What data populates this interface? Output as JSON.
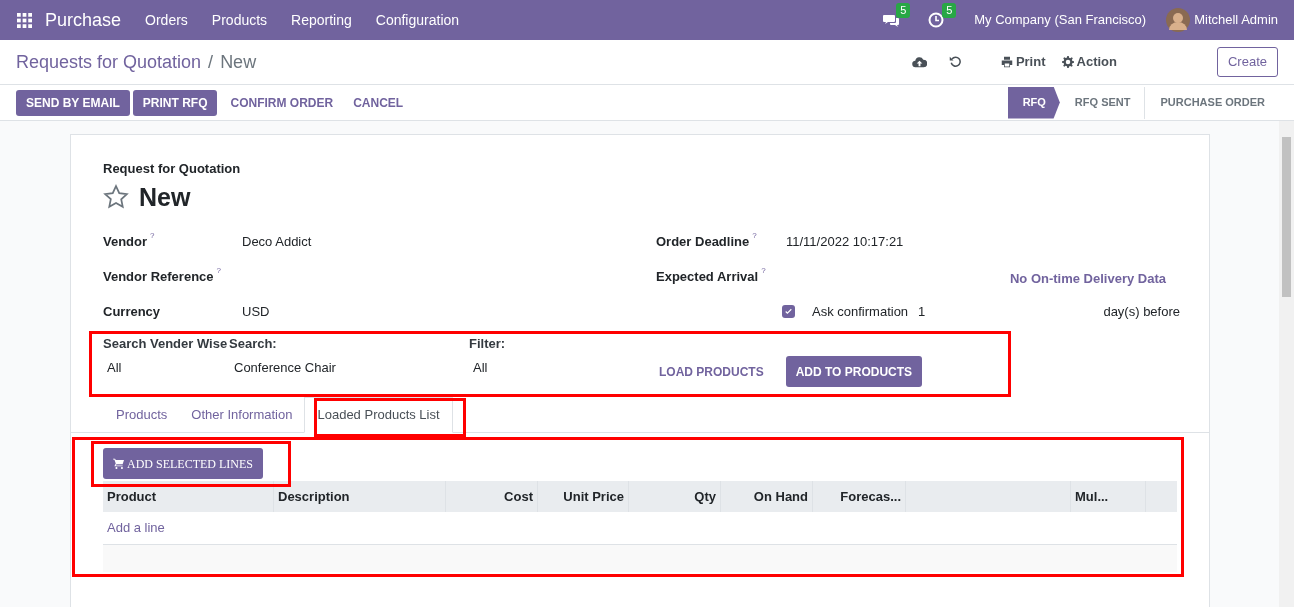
{
  "topbar": {
    "app_name": "Purchase",
    "menu": [
      "Orders",
      "Products",
      "Reporting",
      "Configuration"
    ],
    "messages_count": "5",
    "activities_count": "5",
    "company": "My Company (San Francisco)",
    "user": "Mitchell Admin"
  },
  "breadcrumb": {
    "parent": "Requests for Quotation",
    "separator": "/",
    "current": "New"
  },
  "control_panel": {
    "actions": [
      {
        "kind": "print",
        "label": "Print"
      },
      {
        "kind": "gear",
        "label": "Action"
      }
    ],
    "create": "Create"
  },
  "action_buttons": [
    {
      "label": "SEND BY EMAIL",
      "kind": "primary"
    },
    {
      "label": "PRINT RFQ",
      "kind": "primary"
    },
    {
      "label": "CONFIRM ORDER",
      "kind": "link"
    },
    {
      "label": "CANCEL",
      "kind": "link"
    }
  ],
  "stages": [
    {
      "label": "RFQ",
      "selected": true
    },
    {
      "label": "RFQ SENT",
      "selected": false
    },
    {
      "label": "PURCHASE ORDER",
      "selected": false
    }
  ],
  "form": {
    "subtitle": "Request for Quotation",
    "title": "New",
    "starred": false,
    "left_fields": [
      {
        "label": "Vendor",
        "help": "?",
        "value": "Deco Addict"
      },
      {
        "label": "Vendor Reference",
        "help": "?"
      },
      {
        "label": "Currency",
        "value": "USD"
      }
    ],
    "right_fields": [
      {
        "label": "Order Deadline",
        "help": "?",
        "value": "11/11/2022 10:17:21"
      },
      {
        "label": "Expected Arrival",
        "help": "?",
        "note": "No On-time Delivery Data"
      }
    ],
    "ask_confirmation": {
      "checked": true,
      "label": "Ask confirmation",
      "value": "1",
      "suffix": "day(s) before"
    },
    "search_panel": {
      "vendor_wise": {
        "label": "Search Vender Wise",
        "value": "All"
      },
      "search": {
        "label": "Search:",
        "value": "Conference Chair"
      },
      "filter": {
        "label": "Filter:",
        "value": "All"
      },
      "load_button": "LOAD PRODUCTS",
      "add_button": "ADD TO PRODUCTS"
    },
    "tabs": [
      {
        "label": "Products",
        "selected": false
      },
      {
        "label": "Other Information",
        "selected": false
      },
      {
        "label": "Loaded Products List",
        "selected": true
      }
    ],
    "add_selected_button": "ADD SELECTED LINES",
    "table": {
      "columns": [
        "Product",
        "Description",
        "Cost",
        "Unit Price",
        "Qty",
        "On Hand",
        "Forecas...",
        "Mul..."
      ],
      "add_line": "Add a line"
    }
  }
}
